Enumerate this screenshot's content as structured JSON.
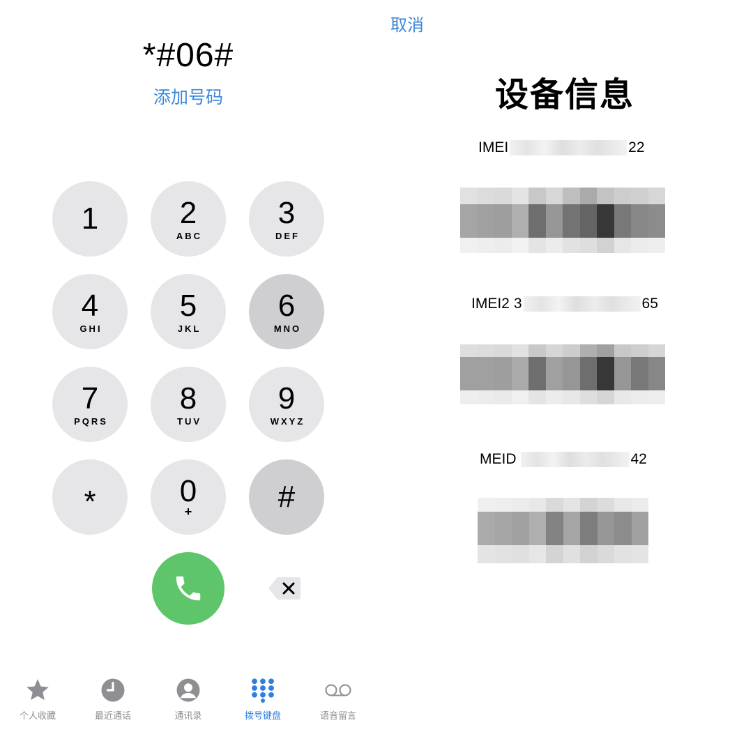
{
  "cancel_label": "取消",
  "dialed_number": "*#06#",
  "add_number_label": "添加号码",
  "keypad": [
    {
      "digit": "1",
      "letters": ""
    },
    {
      "digit": "2",
      "letters": "ABC"
    },
    {
      "digit": "3",
      "letters": "DEF"
    },
    {
      "digit": "4",
      "letters": "GHI"
    },
    {
      "digit": "5",
      "letters": "JKL"
    },
    {
      "digit": "6",
      "letters": "MNO"
    },
    {
      "digit": "7",
      "letters": "PQRS"
    },
    {
      "digit": "8",
      "letters": "TUV"
    },
    {
      "digit": "9",
      "letters": "WXYZ"
    },
    {
      "digit": "*",
      "letters": ""
    },
    {
      "digit": "0",
      "letters": "+"
    },
    {
      "digit": "#",
      "letters": ""
    }
  ],
  "tabs": [
    {
      "label": "个人收藏",
      "icon": "star-icon",
      "active": false
    },
    {
      "label": "最近通话",
      "icon": "clock-icon",
      "active": false
    },
    {
      "label": "通讯录",
      "icon": "contact-icon",
      "active": false
    },
    {
      "label": "拨号键盘",
      "icon": "keypad-icon",
      "active": true
    },
    {
      "label": "语音留言",
      "icon": "voicemail-icon",
      "active": false
    }
  ],
  "device_info": {
    "title": "设备信息",
    "imei": {
      "label": "IMEI",
      "suffix": "22"
    },
    "imei2": {
      "label": "IMEI2",
      "prefix": "3",
      "suffix": "65"
    },
    "meid": {
      "label": "MEID",
      "suffix": "42"
    }
  },
  "colors": {
    "accent": "#3a87d6",
    "call_green": "#5fc56b",
    "key_bg": "#e6e6e9",
    "key_dark": "#cfcfd2",
    "tab_active": "#2f7fe0",
    "tab_inactive": "#8e8e93"
  }
}
